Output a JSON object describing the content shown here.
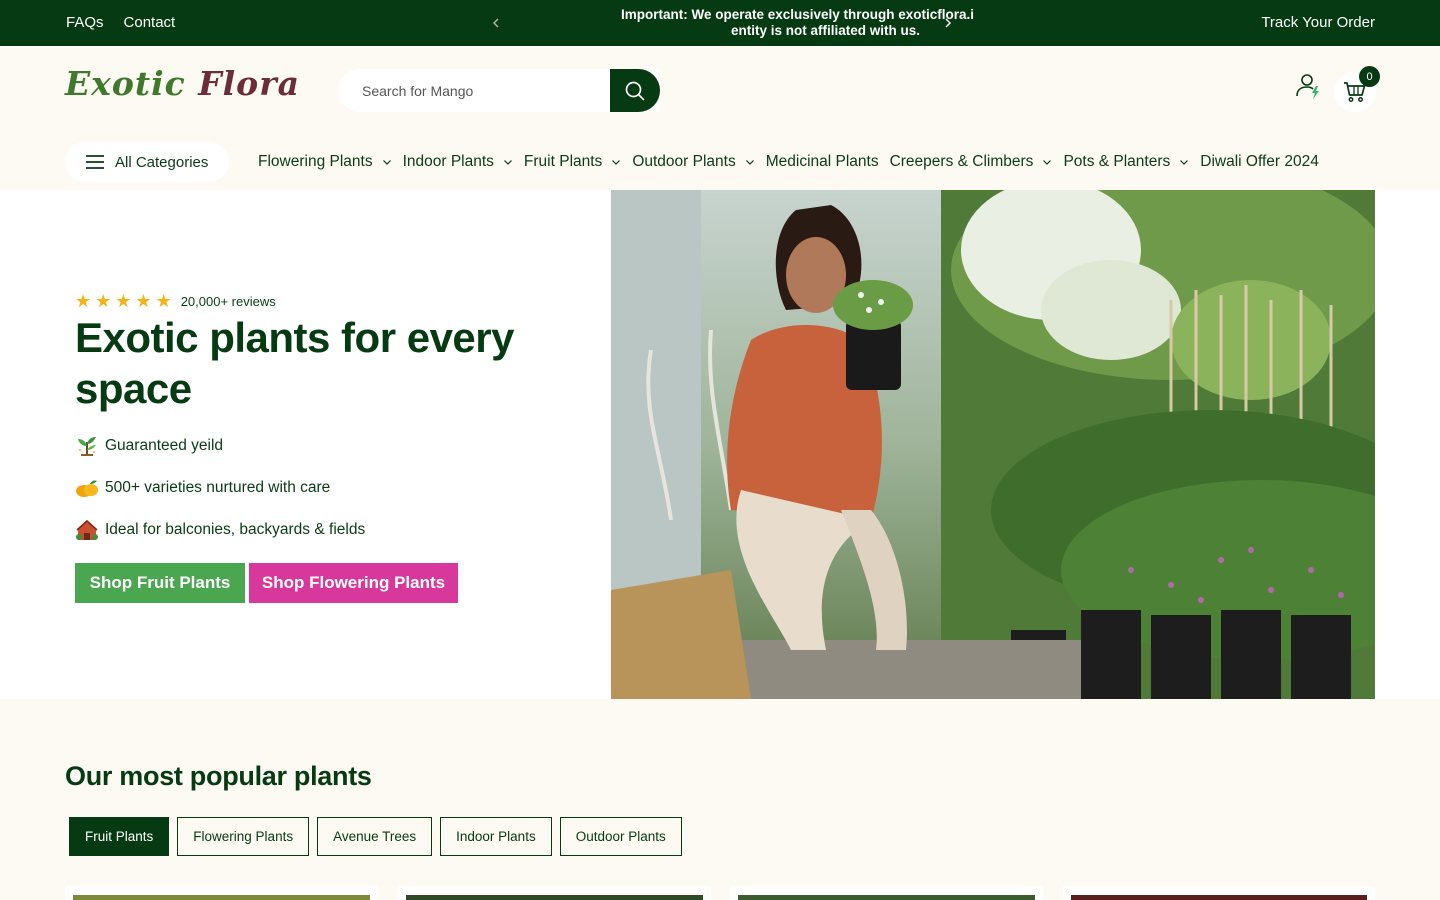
{
  "topbar": {
    "links": [
      "FAQs",
      "Contact"
    ],
    "announcement": "Important: We operate exclusively through exoticflora.i",
    "announcement_line2": "entity is not affiliated with us.",
    "track_order": "Track Your Order",
    "prev_icon": "chevron-left-icon",
    "next_icon": "chevron-right-icon"
  },
  "header": {
    "logo_word1": "Exotic",
    "logo_word2": "Flora",
    "search_placeholder": "Search for Mango",
    "cart_count": "0",
    "icons": [
      "search-icon",
      "account-icon",
      "cart-icon"
    ]
  },
  "nav": {
    "all_categories": "All Categories",
    "items": [
      {
        "label": "Flowering Plants",
        "dropdown": true
      },
      {
        "label": "Indoor Plants",
        "dropdown": true
      },
      {
        "label": "Fruit Plants",
        "dropdown": true
      },
      {
        "label": "Outdoor Plants",
        "dropdown": true
      },
      {
        "label": "Medicinal Plants",
        "dropdown": false
      },
      {
        "label": "Creepers & Climbers",
        "dropdown": true
      },
      {
        "label": "Pots & Planters",
        "dropdown": true
      },
      {
        "label": "Diwali Offer 2024",
        "dropdown": false
      }
    ]
  },
  "hero": {
    "rating_stars": 5,
    "reviews": "20,000+ reviews",
    "title": "Exotic plants for every space",
    "features": [
      {
        "icon": "plant-icon",
        "text": "Guaranteed yeild"
      },
      {
        "icon": "mango-icon",
        "text": "500+ varieties nurtured with care"
      },
      {
        "icon": "house-icon",
        "text": "Ideal for balconies, backyards & fields"
      }
    ],
    "btn_fruit": "Shop Fruit Plants",
    "btn_flower": "Shop Flowering Plants"
  },
  "popular": {
    "title": "Our most popular plants",
    "tabs": [
      "Fruit Plants",
      "Flowering Plants",
      "Avenue Trees",
      "Indoor Plants",
      "Outdoor Plants"
    ],
    "active_tab": "Fruit Plants"
  },
  "colors": {
    "dark_green": "#063a12",
    "fruit_green": "#4aa64f",
    "flower_pink": "#d8389b",
    "cream": "#fdf9f3",
    "star": "#f5b316"
  }
}
